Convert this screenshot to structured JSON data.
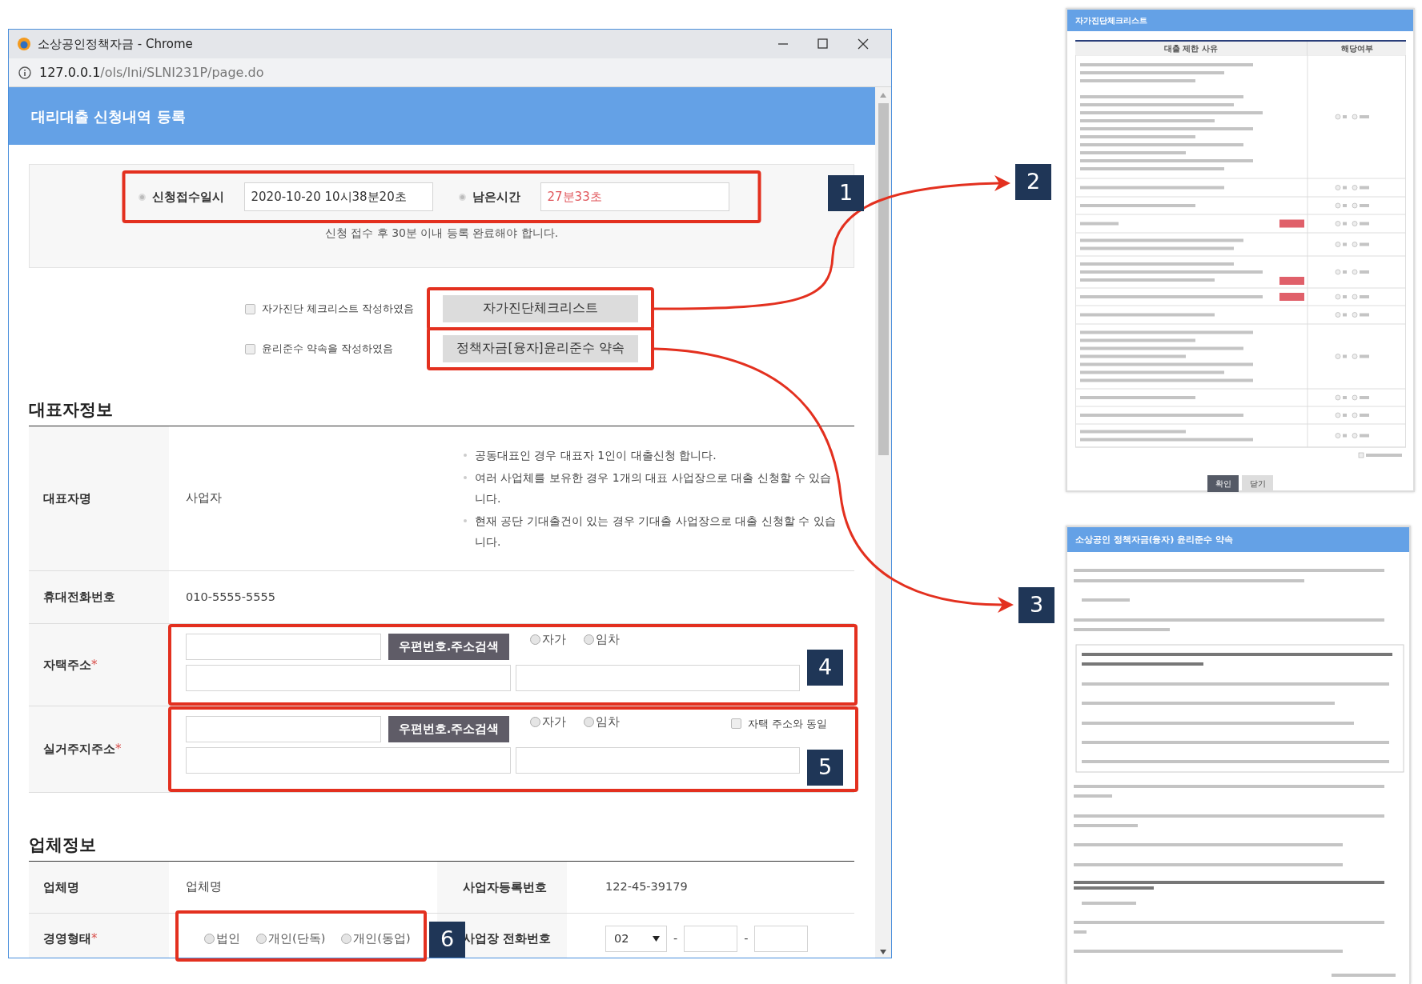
{
  "window": {
    "title": "소상공인정책자금 - Chrome",
    "url_host": "127.0.0.1",
    "url_path": "/ols/lni/SLNI231P/page.do"
  },
  "page_title": "대리대출 신청내역 등록",
  "timer": {
    "received_label": "신청접수일시",
    "received_value": "2020-10-20 10시38분20초",
    "remaining_label": "남은시간",
    "remaining_value": "27분33초",
    "note": "신청 접수 후 30분 이내 등록 완료해야 합니다."
  },
  "agreements": [
    {
      "label": "자가진단 체크리스트 작성하였음",
      "checked": false,
      "button": "자가진단체크리스트"
    },
    {
      "label": "윤리준수 약속을 작성하였음",
      "checked": false,
      "button": "정책자금[융자]윤리준수 약속"
    }
  ],
  "representative": {
    "heading": "대표자정보",
    "rows": [
      {
        "kind": "name",
        "label": "대표자명",
        "value": "사업자",
        "notes": [
          "공동대표인 경우 대표자 1인이 대출신청 합니다.",
          "여러 사업체를 보유한 경우 1개의 대표 사업장으로 대출 신청할 수 있습니다.",
          "현재 공단 기대출건이 있는 경우 기대출 사업장으로 대출 신청할 수 있습니다."
        ]
      },
      {
        "kind": "text",
        "label": "휴대전화번호",
        "value": "010-5555-5555"
      },
      {
        "kind": "address",
        "label": "자택주소",
        "required_mark": "*",
        "search_button": "우편번호.주소검색",
        "options": [
          {
            "label": "자가",
            "selected": false
          },
          {
            "label": "임차",
            "selected": false
          }
        ]
      },
      {
        "kind": "address",
        "label": "실거주지주소",
        "required_mark": "*",
        "search_button": "우편번호.주소검색",
        "options": [
          {
            "label": "자가",
            "selected": false
          },
          {
            "label": "임차",
            "selected": false
          }
        ],
        "same_as": {
          "label": "자택 주소와 동일",
          "checked": false
        }
      }
    ]
  },
  "company": {
    "heading": "업체정보",
    "rows": [
      [
        {
          "kind": "text",
          "label": "업체명",
          "value": "업체명"
        },
        {
          "kind": "text",
          "label": "사업자등록번호",
          "value": "122-45-39179"
        }
      ],
      [
        {
          "kind": "radios",
          "label": "경영형태",
          "required_mark": "*",
          "options": [
            {
              "label": "법인",
              "selected": false
            },
            {
              "label": "개인(단독)",
              "selected": false
            },
            {
              "label": "개인(동업)",
              "selected": false
            }
          ]
        },
        {
          "kind": "phone",
          "label": "사업장 전화번호",
          "area": "02",
          "separators": [
            "-",
            "-"
          ]
        }
      ]
    ]
  },
  "annotations": {
    "badges": [
      "1",
      "2",
      "3",
      "4",
      "5",
      "6"
    ]
  },
  "checklist_popup": {
    "title": "자가진단체크리스트",
    "columns": [
      "대출 제한 사유",
      "해당여부"
    ],
    "buttons": [
      {
        "label": "확인",
        "kind": "primary"
      },
      {
        "label": "닫기",
        "kind": "secondary"
      }
    ]
  },
  "ethics_popup": {
    "title": "소상공인 정책자금(융자) 윤리준수 약속"
  }
}
